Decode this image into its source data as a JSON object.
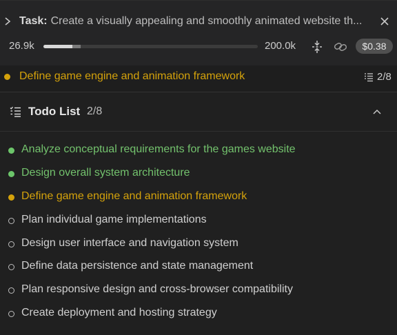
{
  "task": {
    "label": "Task:",
    "text": "Create a visually appealing and smoothly animated website th..."
  },
  "tokens": {
    "used": "26.9k",
    "limit": "200.0k",
    "used_fraction": 0.134,
    "cache_fraction": 0.04,
    "cost": "$0.38"
  },
  "current": {
    "text": "Define game engine and animation framework",
    "count": "2/8"
  },
  "todo": {
    "title": "Todo List",
    "count": "2/8",
    "items": [
      {
        "text": "Analyze conceptual requirements for the games website",
        "status": "done"
      },
      {
        "text": "Design overall system architecture",
        "status": "done"
      },
      {
        "text": "Define game engine and animation framework",
        "status": "active"
      },
      {
        "text": "Plan individual game implementations",
        "status": "pending"
      },
      {
        "text": "Design user interface and navigation system",
        "status": "pending"
      },
      {
        "text": "Define data persistence and state management",
        "status": "pending"
      },
      {
        "text": "Plan responsive design and cross-browser compatibility",
        "status": "pending"
      },
      {
        "text": "Create deployment and hosting strategy",
        "status": "pending"
      }
    ]
  },
  "icons": {
    "expand": "chevron-right-icon",
    "close": "close-icon",
    "condense": "condense-icon",
    "share": "link-icon",
    "list": "list-icon",
    "collapse": "chevron-up-icon"
  },
  "colors": {
    "done": "#73c26d",
    "active": "#d4a20b",
    "pending": "#d0d0d0",
    "background": "#1e1e1e"
  }
}
